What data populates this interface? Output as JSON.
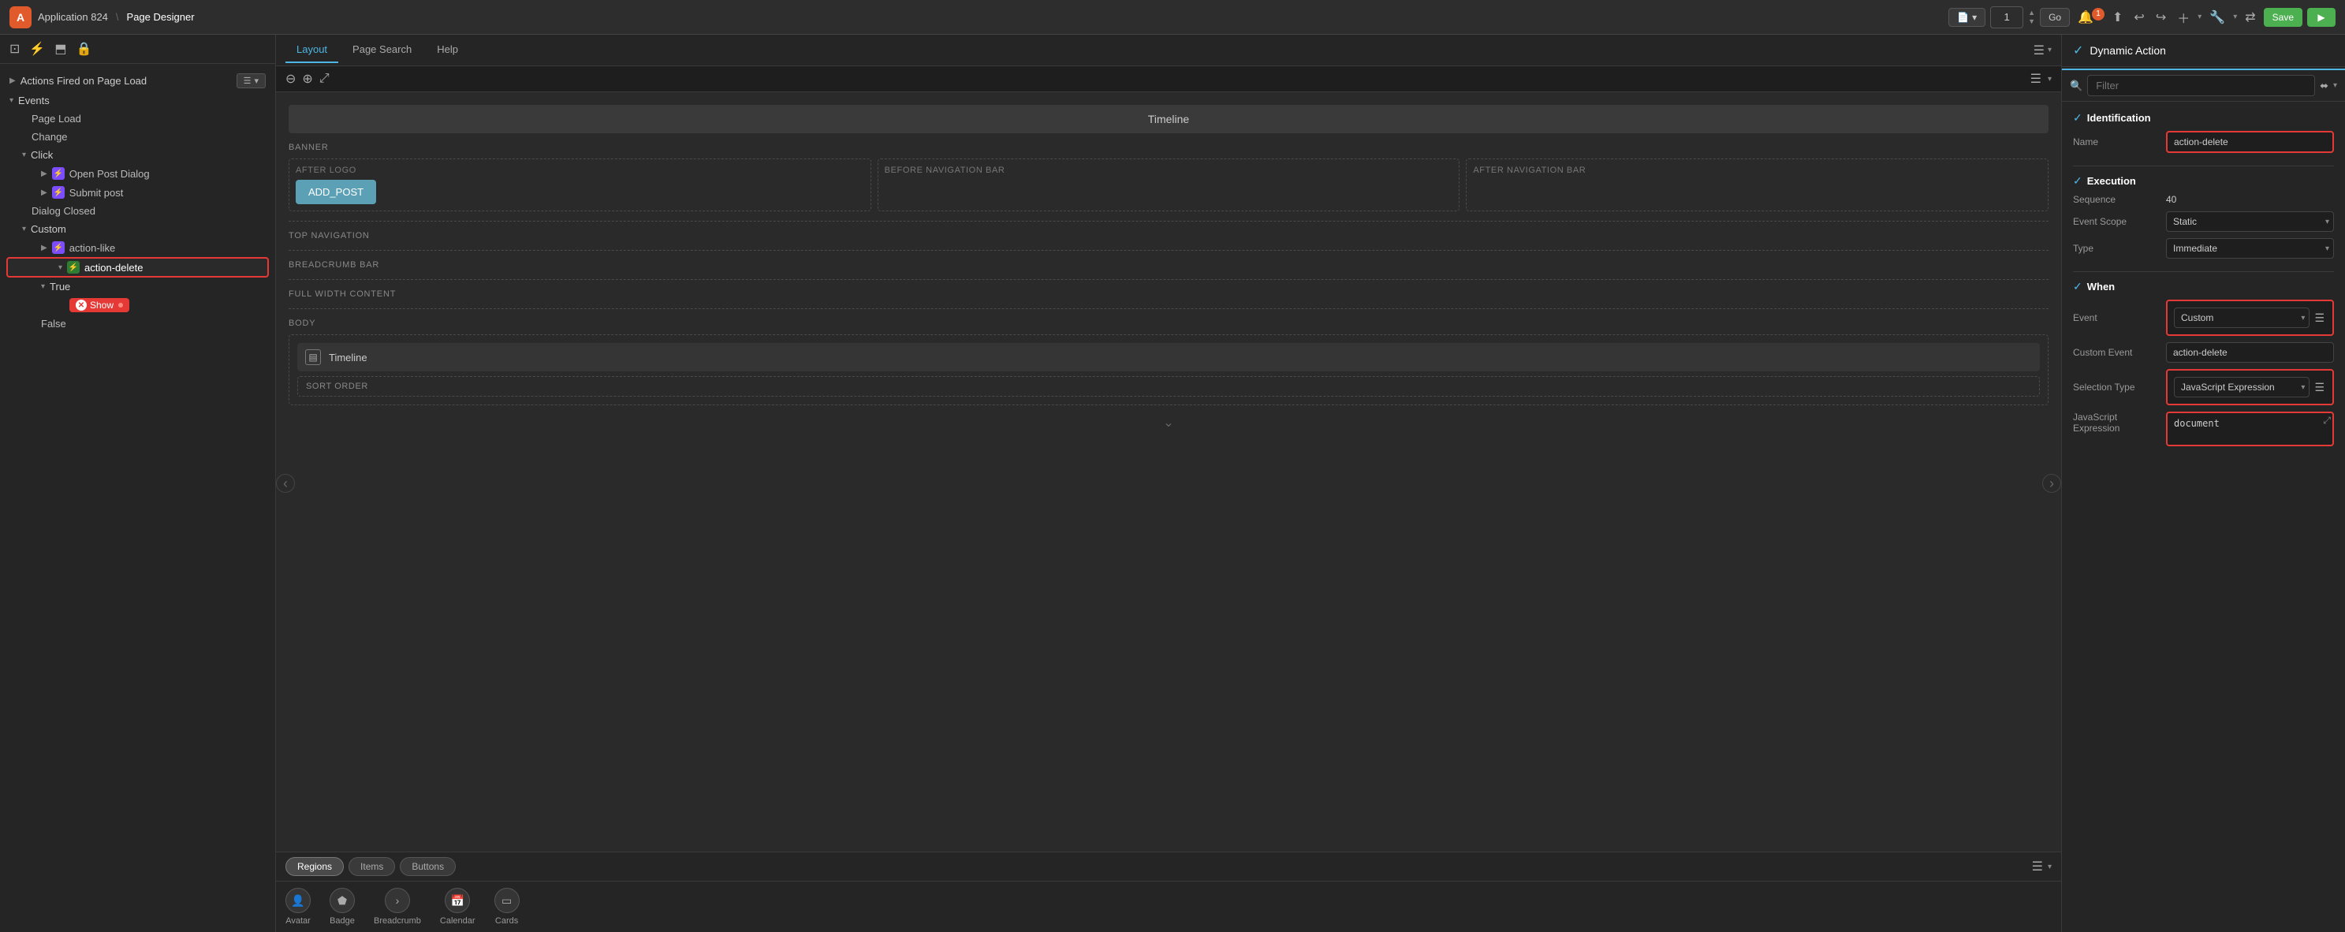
{
  "topbar": {
    "app_icon": "A",
    "app_name": "Application 824",
    "separator": "\\",
    "page_name": "Page Designer",
    "page_num": "1",
    "go_label": "Go",
    "notification_count": "1",
    "save_label": "Save",
    "run_label": "▶"
  },
  "left_panel": {
    "filter_btn_label": "☰",
    "actions_fired_label": "Actions Fired on Page Load",
    "events_label": "Events",
    "page_load_label": "Page Load",
    "change_label": "Change",
    "click_label": "Click",
    "open_post_dialog_label": "Open Post Dialog",
    "submit_post_label": "Submit post",
    "dialog_closed_label": "Dialog Closed",
    "custom_label": "Custom",
    "action_like_label": "action-like",
    "action_delete_label": "action-delete",
    "true_label": "True",
    "show_label": "Show",
    "false_label": "False"
  },
  "center_panel": {
    "tabs": [
      "Layout",
      "Page Search",
      "Help"
    ],
    "active_tab": "Layout",
    "timeline_title": "Timeline",
    "banner_label": "BANNER",
    "after_logo_label": "AFTER LOGO",
    "before_nav_label": "BEFORE NAVIGATION BAR",
    "after_nav_label": "AFTER NAVIGATION BAR",
    "add_post_btn": "ADD_POST",
    "top_nav_label": "TOP NAVIGATION",
    "breadcrumb_bar_label": "BREADCRUMB BAR",
    "full_width_label": "FULL WIDTH CONTENT",
    "body_label": "BODY",
    "timeline_row_label": "Timeline",
    "sort_order_label": "SORT ORDER",
    "bottom_tabs": [
      "Regions",
      "Items",
      "Buttons"
    ],
    "active_bottom_tab": "Regions",
    "components": [
      {
        "label": "Avatar",
        "icon": "👤"
      },
      {
        "label": "Badge",
        "icon": "⬟"
      },
      {
        "label": "Breadcrumb",
        "icon": "›"
      },
      {
        "label": "Calendar",
        "icon": "📅"
      },
      {
        "label": "Cards",
        "icon": "▭"
      }
    ]
  },
  "right_panel": {
    "title": "Dynamic Action",
    "filter_placeholder": "Filter",
    "sections": {
      "identification": {
        "label": "Identification",
        "name_label": "Name",
        "name_value": "action-delete"
      },
      "execution": {
        "label": "Execution",
        "sequence_label": "Sequence",
        "sequence_value": "40",
        "event_scope_label": "Event Scope",
        "event_scope_value": "Static",
        "type_label": "Type",
        "type_value": "Immediate"
      },
      "when": {
        "label": "When",
        "event_label": "Event",
        "event_value": "Custom",
        "custom_event_label": "Custom Event",
        "custom_event_value": "action-delete",
        "selection_type_label": "Selection Type",
        "selection_type_value": "JavaScript Expression",
        "js_expression_label": "JavaScript Expression",
        "js_expression_value": "document"
      }
    }
  }
}
